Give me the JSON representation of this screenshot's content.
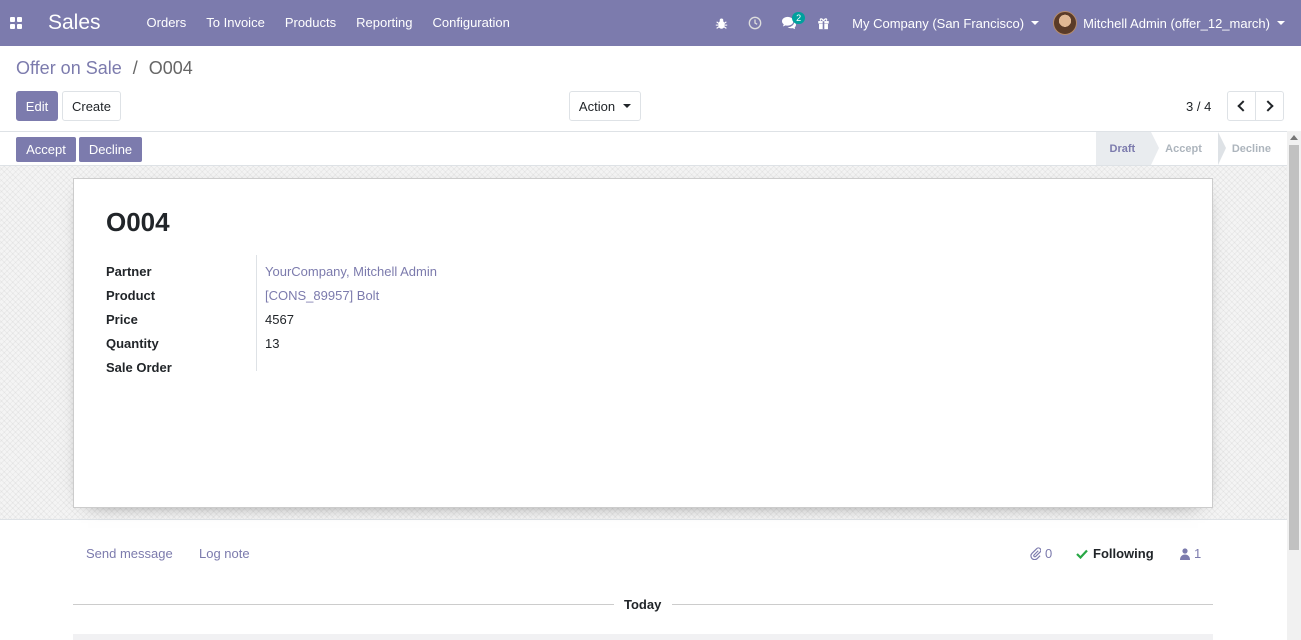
{
  "navbar": {
    "app_name": "Sales",
    "menu": [
      "Orders",
      "To Invoice",
      "Products",
      "Reporting",
      "Configuration"
    ],
    "messages_badge": "2",
    "company": "My Company (San Francisco)",
    "user": "Mitchell Admin (offer_12_march)"
  },
  "breadcrumb": {
    "parent": "Offer on Sale",
    "separator": "/",
    "current": "O004"
  },
  "controls": {
    "edit_label": "Edit",
    "create_label": "Create",
    "action_label": "Action",
    "pager": "3 / 4"
  },
  "statusbar": {
    "accept_label": "Accept",
    "decline_label": "Decline",
    "stages": [
      "Draft",
      "Accept",
      "Decline"
    ],
    "active_stage": "Draft"
  },
  "record": {
    "title": "O004",
    "fields": [
      {
        "label": "Partner",
        "value": "YourCompany, Mitchell Admin"
      },
      {
        "label": "Product",
        "value": "[CONS_89957] Bolt"
      },
      {
        "label": "Price",
        "value": "4567"
      },
      {
        "label": "Quantity",
        "value": "13"
      },
      {
        "label": "Sale Order",
        "value": ""
      }
    ]
  },
  "chatter": {
    "send_message": "Send message",
    "log_note": "Log note",
    "attachments": "0",
    "following": "Following",
    "followers": "1",
    "today": "Today"
  },
  "colors": {
    "brand": "#7c7bad",
    "badge": "#00a09d",
    "following_check": "#28a745"
  }
}
